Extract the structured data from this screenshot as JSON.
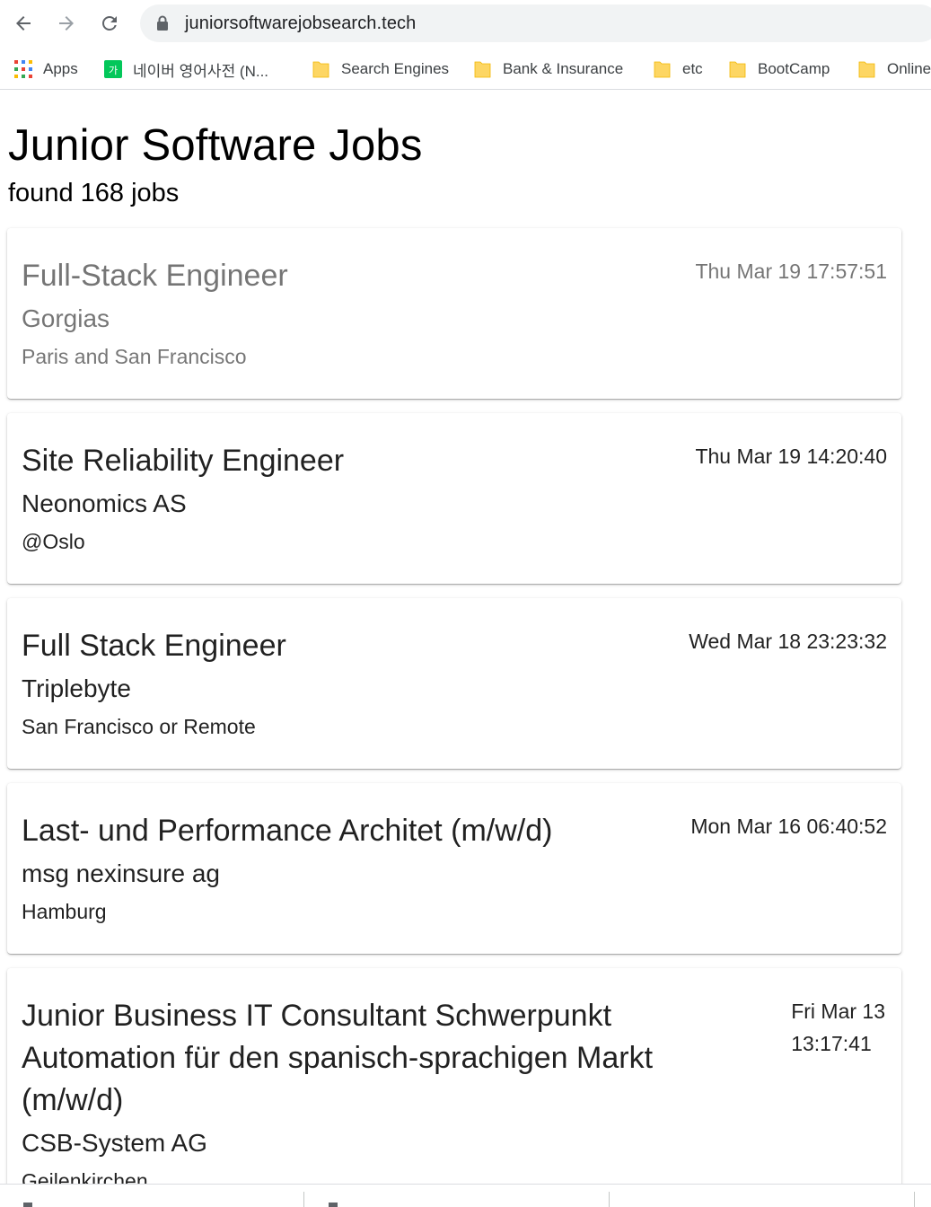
{
  "browser": {
    "url": "juniorsoftwarejobsearch.tech",
    "bookmarks": [
      {
        "label": "Apps",
        "icon": "apps-grid-icon"
      },
      {
        "label": "네이버 영어사전 (N...",
        "icon": "naver-dictionary-icon"
      },
      {
        "label": "Search Engines",
        "icon": "folder-icon"
      },
      {
        "label": "Bank & Insurance",
        "icon": "folder-icon"
      },
      {
        "label": "etc",
        "icon": "folder-icon"
      },
      {
        "label": "BootCamp",
        "icon": "folder-icon"
      },
      {
        "label": "Online",
        "icon": "folder-icon"
      }
    ]
  },
  "page": {
    "title": "Junior Software Jobs",
    "found": "found 168 jobs"
  },
  "jobs": [
    {
      "title": "Full-Stack Engineer",
      "company": "Gorgias",
      "location": "Paris and San Francisco",
      "date": "Thu Mar 19 17:57:51",
      "visited": true
    },
    {
      "title": "Site Reliability Engineer",
      "company": "Neonomics AS",
      "location": "@Oslo",
      "date": "Thu Mar 19 14:20:40",
      "visited": false
    },
    {
      "title": "Full Stack Engineer",
      "company": "Triplebyte",
      "location": "San Francisco or Remote",
      "date": "Wed Mar 18 23:23:32",
      "visited": false
    },
    {
      "title": "Last- und Performance Architet (m/w/d)",
      "company": "msg nexinsure ag",
      "location": "Hamburg",
      "date": "Mon Mar 16 06:40:52",
      "visited": false
    },
    {
      "title_lines": [
        "Junior Business IT Consultant Schwerpunkt",
        "Automation für den spanisch-sprachigen Markt",
        "(m/w/d)"
      ],
      "company": "CSB-System AG",
      "location": "Geilenkirchen",
      "date_lines": [
        "Fri Mar 13",
        "13:17:41"
      ],
      "visited": false
    }
  ],
  "colors": {
    "folder": "#fdd663",
    "visited_text": "#757575",
    "text": "#212121",
    "naver_green": "#03c75a"
  }
}
